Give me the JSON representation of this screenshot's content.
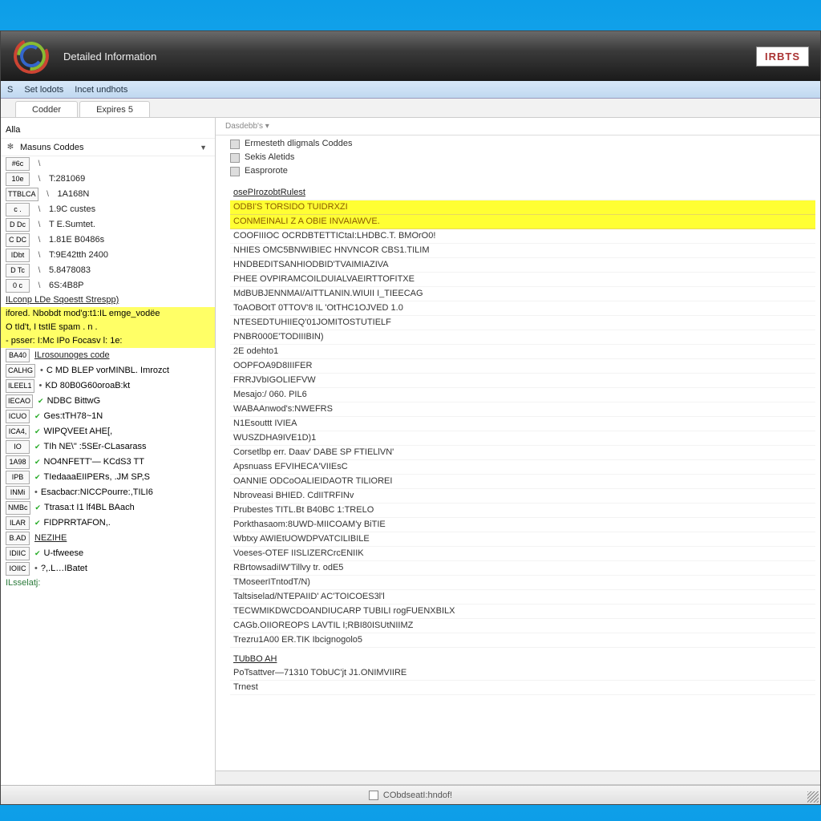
{
  "app": {
    "title": "Detailed Information",
    "brand": "IRBTS"
  },
  "menubar": [
    "S",
    "Set lodots",
    "Incet undhots"
  ],
  "tabs": [
    "Codder",
    "Expires 5"
  ],
  "sidebar_caption": "Alla",
  "sidebar": {
    "section_title": "Masuns Coddes",
    "codes": [
      {
        "badge": "#6c",
        "value": ""
      },
      {
        "badge": "10e",
        "value": "T:281069"
      },
      {
        "badge": "TTBLCA",
        "value": "1A168N"
      },
      {
        "badge": "c .",
        "value": "1.9C custes"
      },
      {
        "badge": "D Dc",
        "value": "T E.Sumtet."
      },
      {
        "badge": "C DC",
        "value": "1.81E B0486s"
      },
      {
        "badge": "IDbt",
        "value": "T:9E42tth 2400"
      },
      {
        "badge": "D Tc",
        "value": "5.8478083"
      },
      {
        "badge": "0 c",
        "value": "6S:4B8P"
      }
    ],
    "group_label": "ILconp  LDe Sqoestt Strespp)",
    "highlighted": [
      "ifored.  Nbobdt mod'g:t1:IL emge_vodëe",
      "O tId't, I tstIE  spam . n .",
      "- psser: I:Mc IPo Focasv l: 1e:"
    ],
    "lower_items": [
      {
        "badge": "BA40",
        "text": "ILrosounoges code",
        "link": true
      },
      {
        "badge": "CALHG",
        "text": "C MD BLEP vorMINBL. Imrozct",
        "check": false
      },
      {
        "badge": "ILEEL1",
        "text": "KD 80B0G60oroaB:kt",
        "check": false
      },
      {
        "badge": "IECAO",
        "text": "NDBC  BittwG",
        "check": true
      },
      {
        "badge": "ICUO",
        "text": "Ges:tTH78~1N",
        "check": true
      },
      {
        "badge": "ICA4,",
        "text": "WIPQVEEt AHE[,",
        "check": true
      },
      {
        "badge": "IO",
        "text": "TIh NE\\\"  :5SEr-CLasarass",
        "check": true
      },
      {
        "badge": "1A98",
        "text": "NO4NFETT'— KCdS3 TT",
        "check": true
      },
      {
        "badge": "IPB",
        "text": "TIedaaaEIIPERs, .JM SP,S",
        "check": true
      },
      {
        "badge": "INMi",
        "text": "Esacbacr:NICCPourre:,TILI6",
        "check": false
      },
      {
        "badge": "NMBc",
        "text": "Ttrasa:t  I1 lf4BL BAach",
        "check": true
      },
      {
        "badge": "ILAR",
        "text": "FIDPRRTAFON,.",
        "check": true
      },
      {
        "badge": "B.AD",
        "text": "NEZIHE",
        "link": true
      },
      {
        "badge": "IDIIC",
        "text": "U-tfweese",
        "check": true
      },
      {
        "badge": "IOIIC",
        "text": "?,.L…IBatet",
        "check": false
      }
    ],
    "footer_link": "ILsselatj:"
  },
  "main": {
    "header_label": "Dasdebb's ▾",
    "summary": [
      "Ermesteth dligmals Coddes",
      "Sekis Aletids",
      "Easprorote"
    ],
    "list_heading": "osePIrozobtRulest",
    "highlights": [
      "ODBI'S TORSIDO TUIDRXZI",
      "CONMEINALI Z A OBIE INVAIAWVE."
    ],
    "lines": [
      "COOFIIIOC OCRDBTETTICtaI:LHDBC.T. BMOrO0!",
      "NHIES OMC5BNWIBIEC HNVNCOR CBS1.TILIM",
      "HNDBEDITSANHIODBID'TVAIMIAZIVA",
      "PHEE OVPIRAMCOILDUIALVAEIRTTOFITXE",
      "MdBUBJENNMAI/AITTLANIN.WIUII I_TIEECAG",
      "ToAOBOtT 0TTOV'8 IL 'OtTHC1OJVED 1.0",
      "NTESEDTUHIIEQ'01JOMITOSTUTIELF",
      "PNBR000E'TODIIIBIN)",
      "2E odehto1",
      "OOPFOA9D8IIIFER",
      "FRRJVbIGOLIEFVW",
      "Mesajo:/ 060. PIL6",
      "WABAAnwod's:NWEFRS",
      "N1Esouttt IVIEA",
      "WUSZDHA9IVE1D)1",
      "Corsetlbp err. Daav' DABE SP FTIELlVN'",
      "Apsnuass EFVIHECA'VIIEsC",
      "OANNIE ODCoOALIEIDAOTR TILIOREI",
      "Nbroveasi BHIED. CdIITRFINv",
      "Prubestes TITL.Bt B40BC 1:TRELO",
      "Porkthasaom:8UWD-MIICOAM'y BiTIE",
      "Wbtxy  AWIEtUOWDPVATCILIBILE",
      "Voeses-OTEF IISLIZERCrcENIIK",
      "RBrtowsadiIW'Tillvy tr. odE5",
      "TMoseerITntodT/N)",
      "Taltsiselad/NTEPAIID' AC'TOICOES3l'l",
      "TECWMIKDWCDOANDIUCARP TUBILI rogFUENXBILX",
      "CAGb.OIIOREOPS LAVTIL I;RBI80ISUtNIIMZ",
      "Trezru1A00 ER.TIK Ibcignogolo5"
    ],
    "section2_title": "TUbBO AH",
    "section2_lines": [
      "PoTsattver—71310 TObUC'jt J1.ONIMVIIRE",
      "Trnest"
    ]
  },
  "statusbar": "CObdseatI:hndof!"
}
